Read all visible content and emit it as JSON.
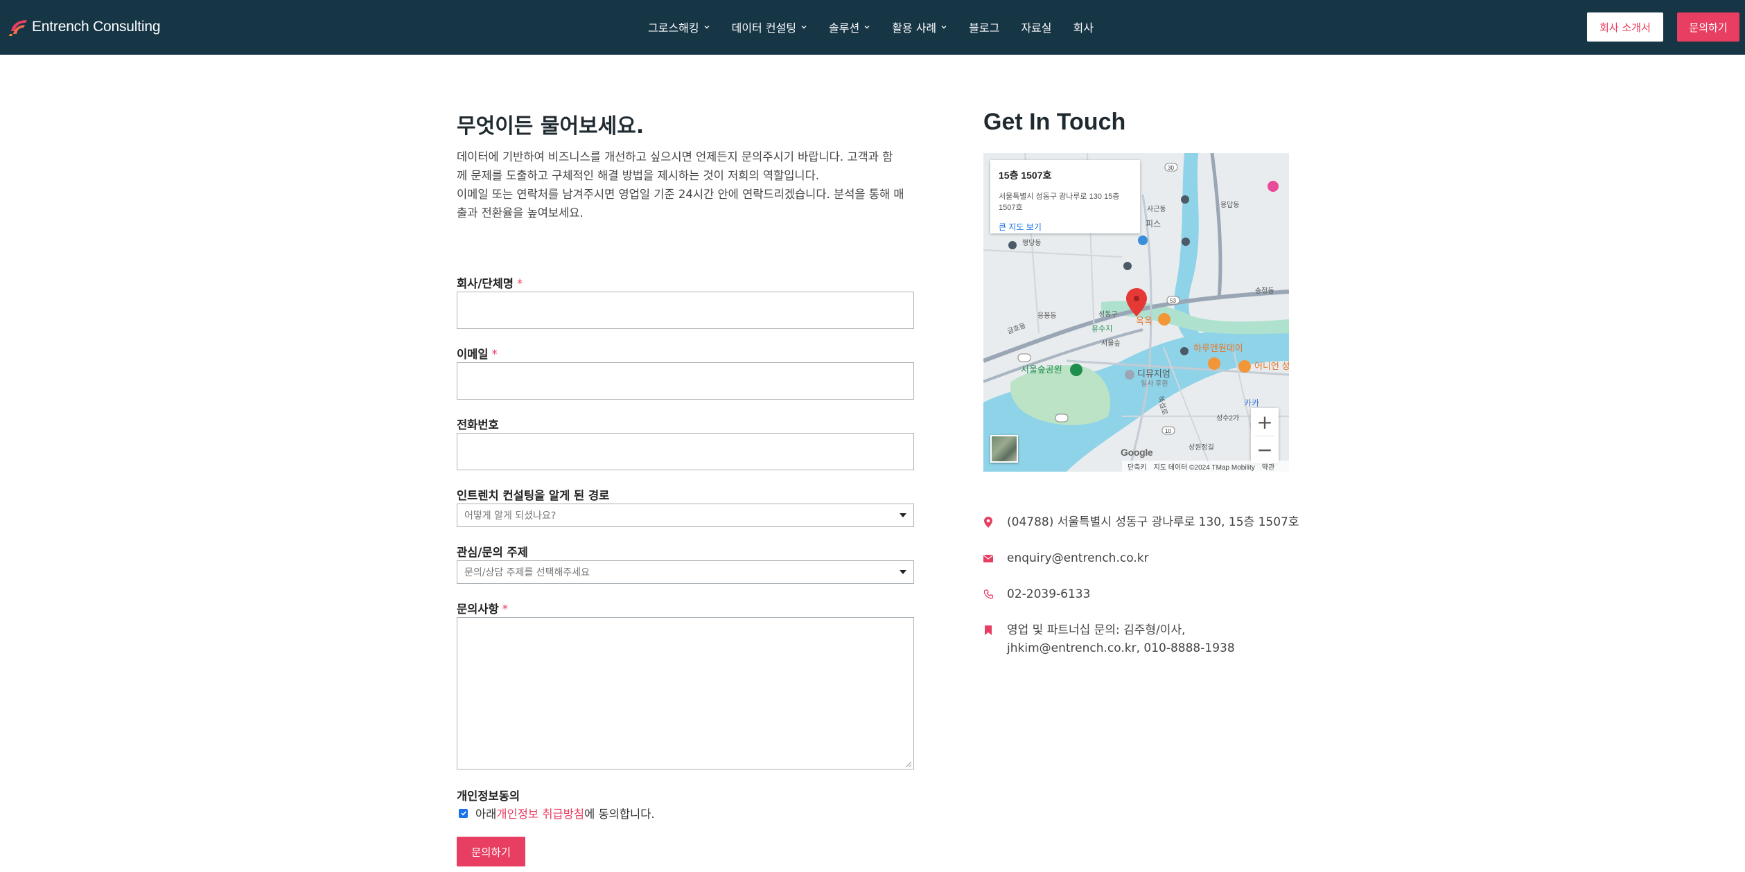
{
  "brand": {
    "name": "Entrench Consulting",
    "accent": "#e83e62",
    "header_bg": "#163545"
  },
  "nav": {
    "items": [
      {
        "label": "그로스해킹",
        "has_dropdown": true
      },
      {
        "label": "데이터 컨설팅",
        "has_dropdown": true
      },
      {
        "label": "솔루션",
        "has_dropdown": true
      },
      {
        "label": "활용 사례",
        "has_dropdown": true
      },
      {
        "label": "블로그",
        "has_dropdown": false
      },
      {
        "label": "자료실",
        "has_dropdown": false
      },
      {
        "label": "회사",
        "has_dropdown": false
      }
    ],
    "intro_button": "회사 소개서",
    "inquiry_button": "문의하기"
  },
  "form": {
    "title": "무엇이든 물어보세요.",
    "intro_lines": [
      "데이터에 기반하여 비즈니스를 개선하고 싶으시면 언제든지  문의주시기 바랍니다. 고객과 함",
      "께 문제를 도출하고 구체적인 해결 방법을 제시하는 것이 저희의 역할입니다.",
      "이메일 또는 연락처를 남겨주시면 영업일 기준 24시간 안에 연락드리겠습니다. 분석을 통해 매",
      "출과 전환율을 높여보세요."
    ],
    "company_label": "회사/단체명",
    "email_label": "이메일",
    "phone_label": "전화번호",
    "source_label": "인트렌치 컨설팅을 알게 된 경로",
    "source_placeholder": "어떻게 알게 되셨나요?",
    "topic_label": "관심/문의 주제",
    "topic_placeholder": "문의/상담 주제를 선택해주세요",
    "message_label": "문의사항",
    "required_mark": "*",
    "consent_title": "개인정보동의",
    "consent_prefix": "아래 ",
    "consent_link": "개인정보 취급방침",
    "consent_suffix": "에 동의합니다.",
    "consent_checked": true,
    "submit": "문의하기"
  },
  "contact": {
    "title": "Get In Touch",
    "map_card": {
      "title": "15층 1507호",
      "address": "서울특별시 성동구 광나루로 130 15층 1507호",
      "link": "큰 지도 보기"
    },
    "map_labels": {
      "okok": "옥옥",
      "haru": "하루엔원데이",
      "onion": "어니언 성수",
      "seoulforest": "서울숲공원",
      "dijiyeom": "디뮤지엄",
      "ilsa": "일사 후원",
      "eungbong": "응봉동",
      "seongdong": "성동구",
      "geumho": "금호동",
      "haengdang": "행당동",
      "songjeong": "송정동",
      "seoulsup": "서울숲",
      "yongdap": "용답동",
      "sageun": "사근동",
      "pi": "피스",
      "yusu": "유수지",
      "kaka": "카카",
      "seongsu2": "성수2가",
      "seongsu": "성수동",
      "tsangsu": "뚝섬로",
      "sangwon": "상원정길",
      "road10": "10",
      "road53": "53",
      "road30": "30"
    },
    "zoom_in": "+",
    "zoom_out": "−",
    "google": "Google",
    "map_footer": [
      "단축키",
      "지도 데이터 ©2024 TMap Mobility",
      "약관"
    ],
    "address": "(04788) 서울특별시 성동구 광나루로 130, 15층 1507호",
    "email": "enquiry@entrench.co.kr",
    "phone": "02-2039-6133",
    "partner_line1": "영업 및 파트너십 문의: 김주형/이사,",
    "partner_line2": "jhkim@entrench.co.kr, 010-8888-1938"
  }
}
